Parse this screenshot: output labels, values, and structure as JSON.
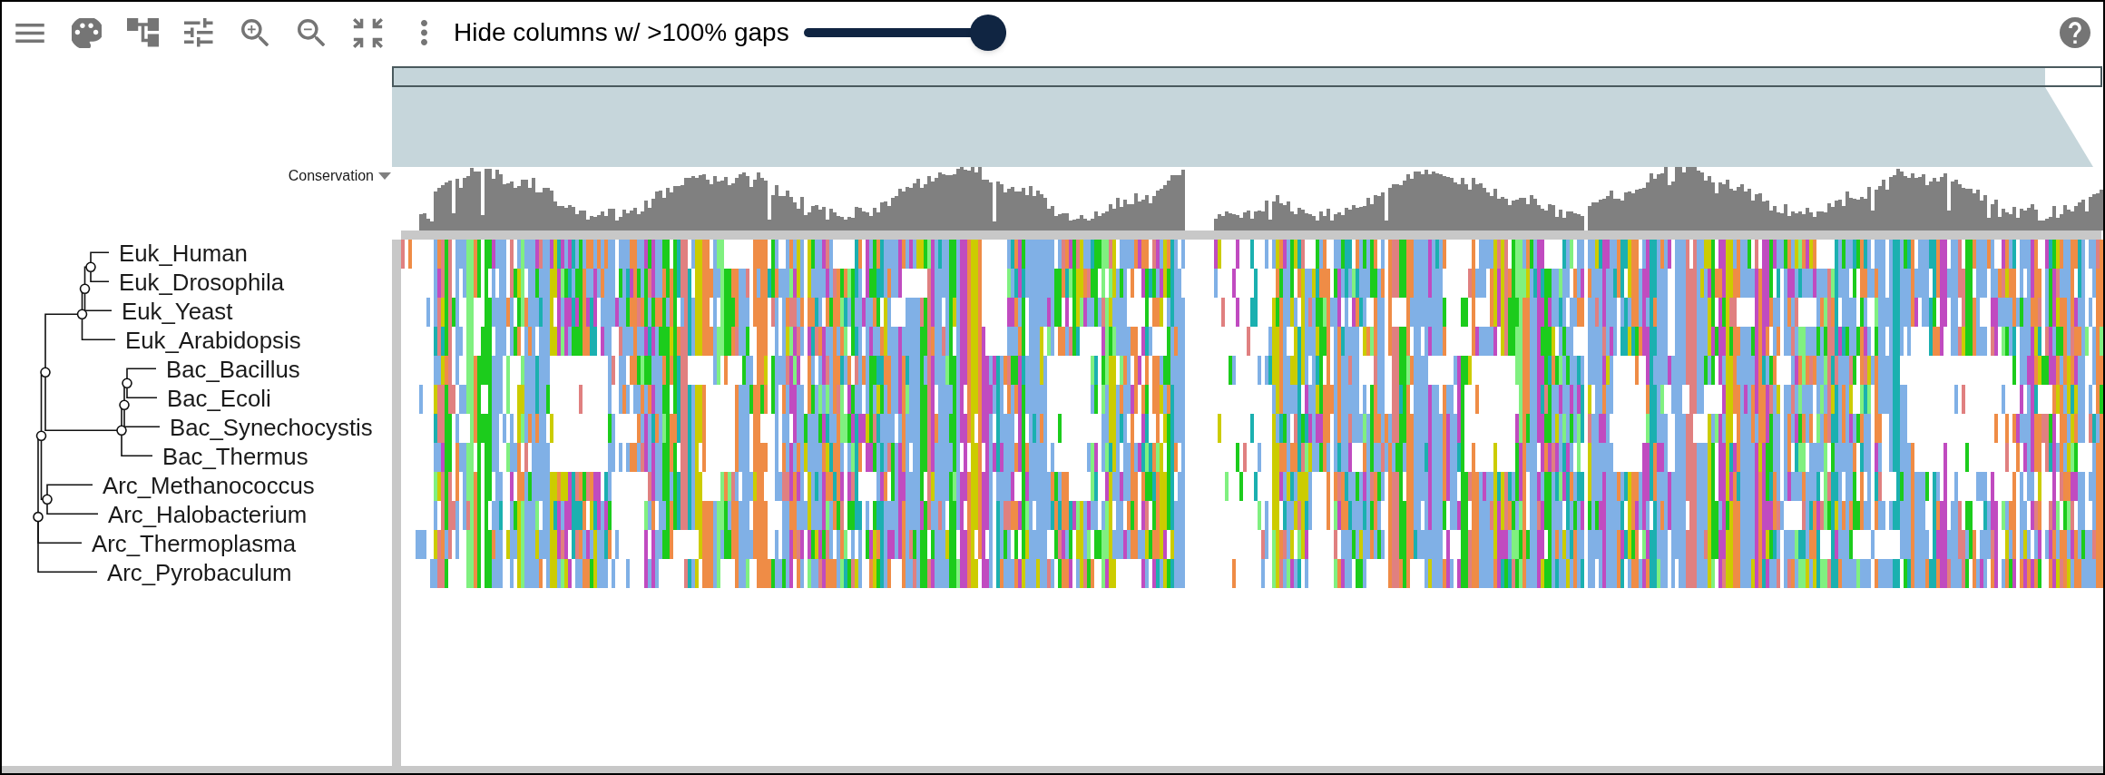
{
  "toolbar": {
    "gap_filter": {
      "label": "Hide columns w/ >100% gaps",
      "level": 1
    }
  },
  "conservation_track": {
    "label": "Conservation"
  },
  "tree": {
    "children": [
      {
        "children": [
          {
            "children": [
              {
                "children": [
                  {
                    "children": [
                      {
                        "children": [
                          {
                            "label": "Euk_Human"
                          },
                          {
                            "label": "Euk_Drosophila"
                          }
                        ]
                      },
                      {
                        "label": "Euk_Yeast"
                      }
                    ]
                  },
                  {
                    "label": "Euk_Arabidopsis"
                  }
                ]
              },
              {
                "children": [
                  {
                    "children": [
                      {
                        "children": [
                          {
                            "label": "Bac_Bacillus"
                          },
                          {
                            "label": "Bac_Ecoli"
                          }
                        ]
                      },
                      {
                        "label": "Bac_Synechocystis"
                      }
                    ]
                  },
                  {
                    "label": "Bac_Thermus"
                  }
                ]
              }
            ]
          },
          {
            "children": [
              {
                "label": "Arc_Methanococcus"
              },
              {
                "label": "Arc_Halobacterium"
              }
            ]
          }
        ]
      },
      {
        "label": "Arc_Thermoplasma"
      },
      {
        "label": "Arc_Pyrobaculum"
      }
    ]
  }
}
